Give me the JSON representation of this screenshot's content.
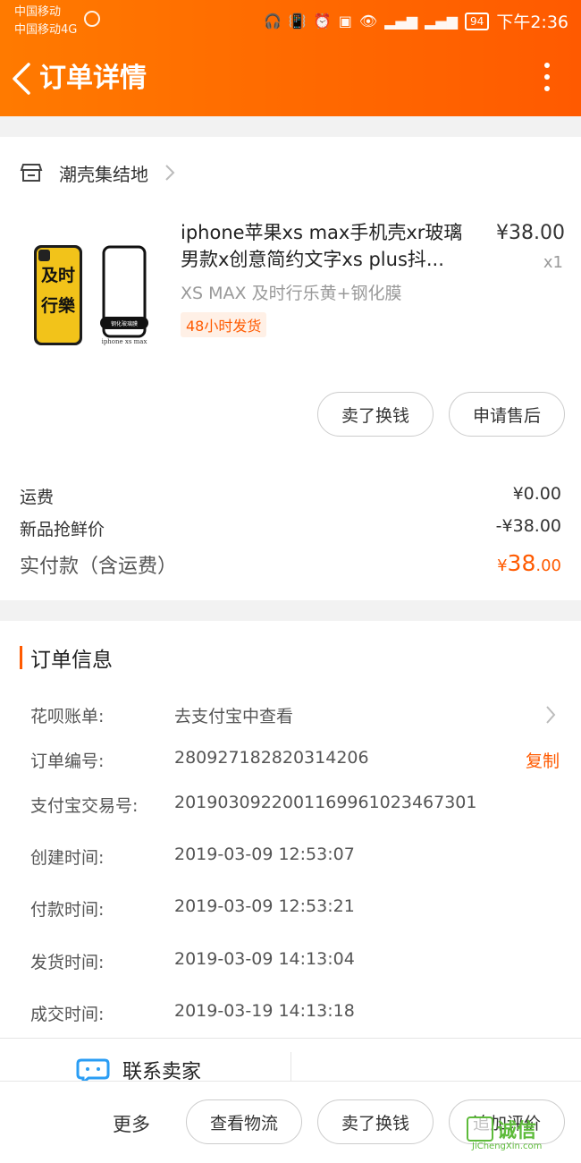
{
  "status_bar": {
    "carrier1": "中国移动",
    "carrier2": "中国移动4G",
    "battery": "94",
    "time": "下午2:36"
  },
  "navbar": {
    "title": "订单详情"
  },
  "shop": {
    "name": "潮壳集结地"
  },
  "product": {
    "title": "iphone苹果xs max手机壳xr玻璃男款x创意简约文字xs plus抖...",
    "price": "¥38.00",
    "quantity": "x1",
    "spec": "XS MAX 及时行乐黄+钢化膜",
    "ship_badge": "48小时发货",
    "image_texts": [
      "及时行樂",
      "钢化玻璃膜",
      "iphone xs max"
    ]
  },
  "item_actions": {
    "sell": "卖了换钱",
    "after_sale": "申请售后"
  },
  "fees": {
    "shipping_label": "运费",
    "shipping_value": "¥0.00",
    "discount_label": "新品抢鲜价",
    "discount_value": "-¥38.00",
    "paid_label": "实付款（含运费）",
    "paid_currency": "¥",
    "paid_int": "38",
    "paid_dec": ".00"
  },
  "order_info": {
    "title": "订单信息",
    "rows": [
      {
        "label": "花呗账单:",
        "value": "去支付宝中查看"
      },
      {
        "label": "订单编号:",
        "value": "280927182820314206",
        "action": "复制"
      },
      {
        "label": "支付宝交易号:",
        "value": "2019030922001169961023467301"
      },
      {
        "label": "创建时间:",
        "value": "2019-03-09 12:53:07"
      },
      {
        "label": "付款时间:",
        "value": "2019-03-09 12:53:21"
      },
      {
        "label": "发货时间:",
        "value": "2019-03-09 14:13:04"
      },
      {
        "label": "成交时间:",
        "value": "2019-03-19 14:13:18"
      }
    ]
  },
  "contact": {
    "label": "联系卖家"
  },
  "bottom_bar": {
    "more": "更多",
    "track": "查看物流",
    "sell": "卖了换钱",
    "review": "追加评价"
  },
  "watermark": {
    "text": "诚信",
    "sub": "JiChengXin.com"
  },
  "colors": {
    "accent": "#ff5a00",
    "header_start": "#ff7a00",
    "background": "#f2f2f2"
  }
}
